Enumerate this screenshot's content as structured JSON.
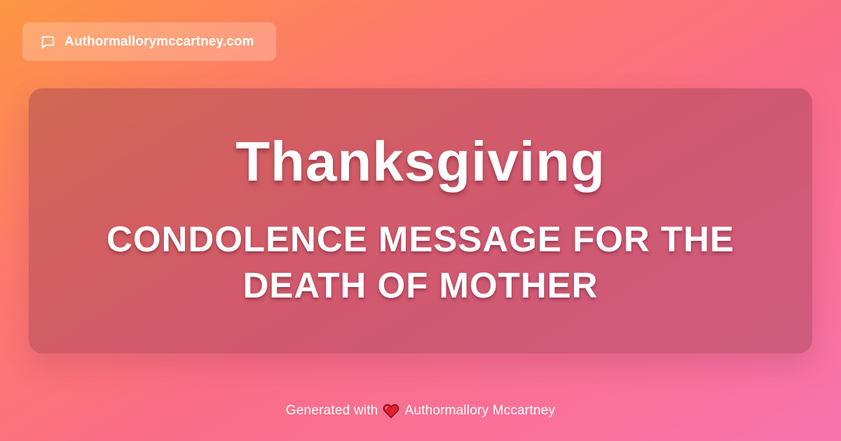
{
  "site": {
    "icon": "chat-bubble-icon",
    "name": "Authormallorymccartney.com"
  },
  "card": {
    "title": "Thanksgiving",
    "subtitle": "CONDOLENCE MESSAGE FOR THE DEATH OF MOTHER"
  },
  "footer": {
    "prefix": "Generated with",
    "icon": "heart-icon",
    "brand": "Authormallory Mccartney"
  },
  "colors": {
    "gradient_start": "#fd9642",
    "gradient_mid": "#fb6e86",
    "gradient_end": "#f774ab",
    "heart": "#e0202e"
  }
}
